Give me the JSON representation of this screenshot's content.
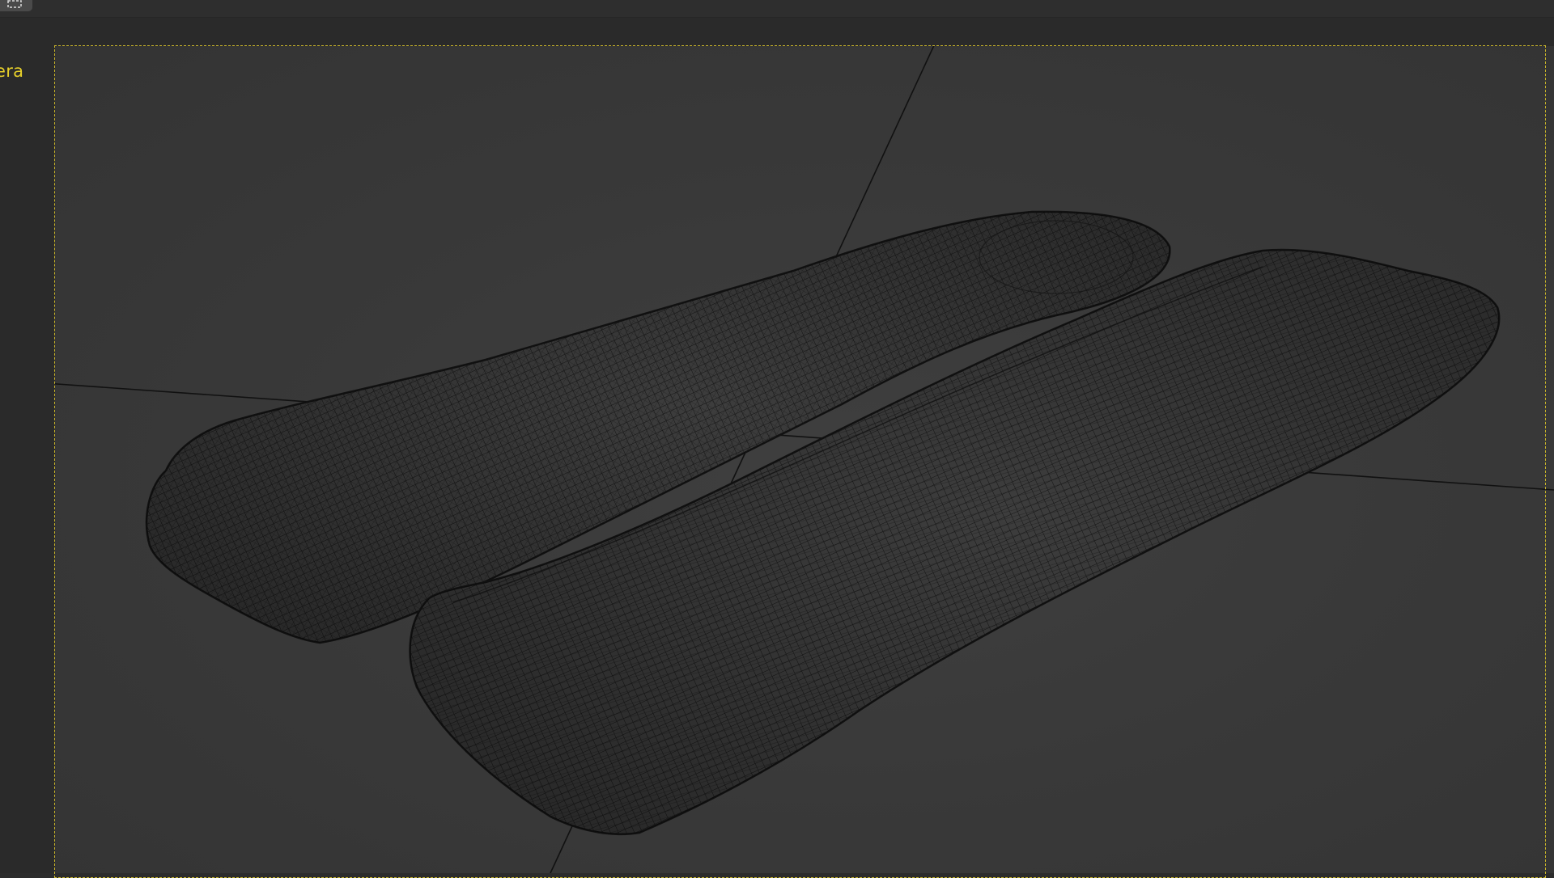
{
  "viewport": {
    "camera_label": "era",
    "frame_color": "#c9b52a",
    "label_color": "#e6cf2a",
    "background_color": "#3a3a3a",
    "wire_color": "#1a1a1a"
  },
  "topbar": {
    "corner_button_icon": "view-frame-icon"
  }
}
